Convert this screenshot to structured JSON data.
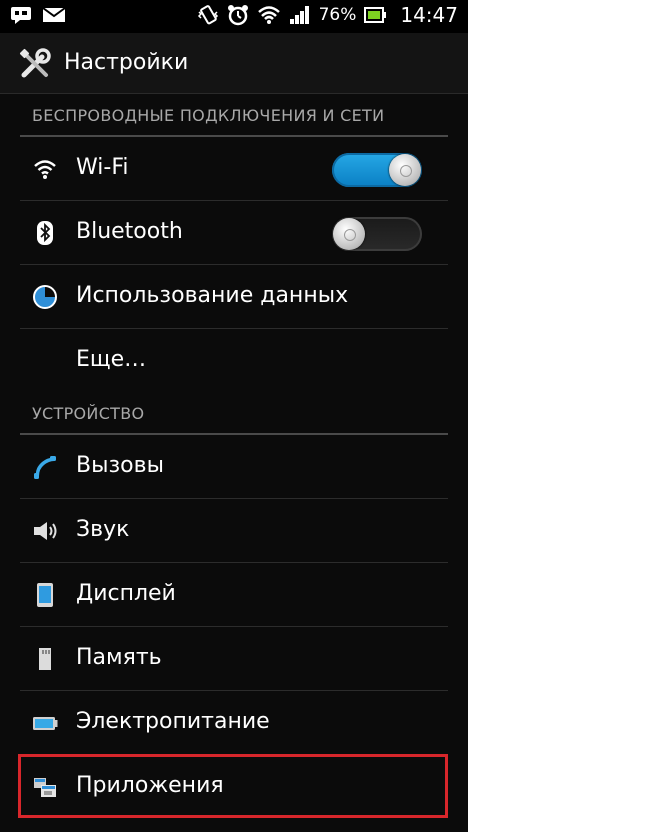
{
  "status_bar": {
    "battery_percent": "76%",
    "time": "14:47",
    "icons": [
      "message-icon",
      "mail-icon",
      "vibrate-icon",
      "alarm-icon",
      "wifi-signal-icon",
      "cell-signal-icon",
      "battery-icon"
    ]
  },
  "action_bar": {
    "title": "Настройки",
    "icon": "settings-tools-icon"
  },
  "sections": [
    {
      "header": "БЕСПРОВОДНЫЕ ПОДКЛЮЧЕНИЯ И СЕТИ",
      "items": [
        {
          "label": "Wi-Fi",
          "icon": "wifi-icon",
          "toggle": "on"
        },
        {
          "label": "Bluetooth",
          "icon": "bluetooth-icon",
          "toggle": "off"
        },
        {
          "label": "Использование данных",
          "icon": "data-usage-icon"
        },
        {
          "label": "Еще…",
          "icon": ""
        }
      ]
    },
    {
      "header": "УСТРОЙСТВО",
      "items": [
        {
          "label": "Вызовы",
          "icon": "phone-call-icon"
        },
        {
          "label": "Звук",
          "icon": "speaker-icon"
        },
        {
          "label": "Дисплей",
          "icon": "display-icon"
        },
        {
          "label": "Память",
          "icon": "memory-card-icon"
        },
        {
          "label": "Электропитание",
          "icon": "battery-power-icon"
        },
        {
          "label": "Приложения",
          "icon": "apps-icon",
          "highlighted": true
        }
      ]
    }
  ],
  "colors": {
    "background": "#0b0b0b",
    "accent_toggle": "#1a97dc",
    "highlight_border": "#d8262b",
    "battery_green": "#7ed321"
  }
}
